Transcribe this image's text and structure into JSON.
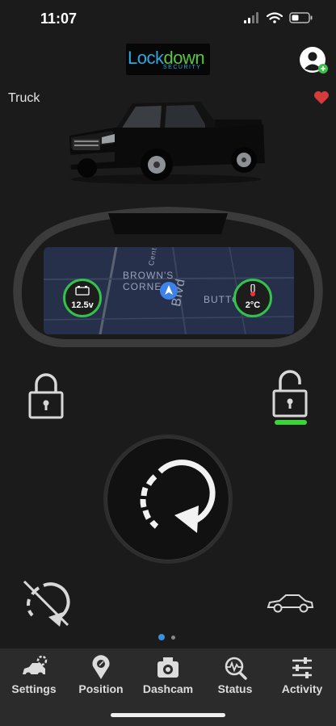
{
  "status_bar": {
    "time": "11:07"
  },
  "header": {
    "logo_lock": "Lock",
    "logo_down": "down",
    "logo_sub": "SECURITY"
  },
  "vehicle": {
    "name": "Truck"
  },
  "dashboard": {
    "map_labels": [
      "BROWN'S",
      "CORNE",
      "BUTTO",
      "Blvd",
      "Centr"
    ],
    "battery_value": "12.5v",
    "temperature_value": "2°C"
  },
  "controls": {
    "lock_icon": "lock-icon",
    "unlock_icon": "unlock-icon",
    "remote_start_icon": "remote-start-icon",
    "cancel_start_icon": "cancel-start-icon",
    "car_icon": "car-icon"
  },
  "pager": {
    "pages": 2,
    "active": 1
  },
  "tabs": [
    {
      "label": "Settings",
      "icon": "car-settings-icon"
    },
    {
      "label": "Position",
      "icon": "map-pin-icon"
    },
    {
      "label": "Dashcam",
      "icon": "dashcam-icon"
    },
    {
      "label": "Status",
      "icon": "status-icon"
    },
    {
      "label": "Activity",
      "icon": "sliders-icon"
    }
  ],
  "colors": {
    "background": "#1b1b1b",
    "accent_green": "#35c24c",
    "heart_red": "#d63a3a",
    "logo_blue": "#2aa8e0",
    "logo_green": "#58c63e",
    "pager_active": "#3a8ee0"
  }
}
